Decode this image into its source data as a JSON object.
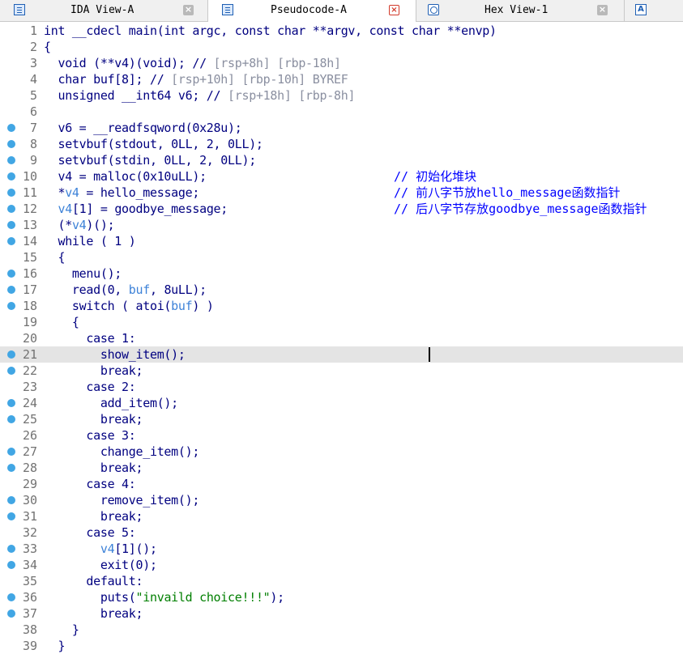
{
  "tabs": [
    {
      "label": "IDA View-A",
      "icon": "ida-view-icon",
      "active": false
    },
    {
      "label": "Pseudocode-A",
      "icon": "pseudocode-icon",
      "active": true
    },
    {
      "label": "Hex View-1",
      "icon": "hex-view-icon",
      "active": false
    },
    {
      "label": "",
      "icon": "structures-icon",
      "active": false
    }
  ],
  "close_glyph": "×",
  "struct_icon_glyph": "A",
  "code": {
    "highlighted_line": 21,
    "lines": [
      {
        "n": "1",
        "bp": false,
        "tokens": [
          [
            "int __cdecl main(int argc, const char **argv, const char **envp)",
            ""
          ]
        ]
      },
      {
        "n": "2",
        "bp": false,
        "tokens": [
          [
            "{",
            ""
          ]
        ]
      },
      {
        "n": "3",
        "bp": false,
        "tokens": [
          [
            "  void (**v4)(void); // ",
            ""
          ],
          [
            "[rsp+8h] [rbp-18h]",
            "gc"
          ]
        ]
      },
      {
        "n": "4",
        "bp": false,
        "tokens": [
          [
            "  char buf[8]; // ",
            ""
          ],
          [
            "[rsp+10h] [rbp-10h] BYREF",
            "gc"
          ]
        ]
      },
      {
        "n": "5",
        "bp": false,
        "tokens": [
          [
            "  unsigned __int64 v6; // ",
            ""
          ],
          [
            "[rsp+18h] [rbp-8h]",
            "gc"
          ]
        ]
      },
      {
        "n": "6",
        "bp": false,
        "tokens": []
      },
      {
        "n": "7",
        "bp": true,
        "tokens": [
          [
            "  v6 = __readfsqword(0x28u);",
            ""
          ]
        ]
      },
      {
        "n": "8",
        "bp": true,
        "tokens": [
          [
            "  setvbuf(stdout, 0LL, 2, 0LL);",
            ""
          ]
        ]
      },
      {
        "n": "9",
        "bp": true,
        "tokens": [
          [
            "  setvbuf(stdin, 0LL, 2, 0LL);",
            ""
          ]
        ]
      },
      {
        "n": "10",
        "bp": true,
        "tokens": [
          [
            "  v4 = malloc(0x10uLL);",
            ""
          ]
        ],
        "comment": "// 初始化堆块"
      },
      {
        "n": "11",
        "bp": true,
        "tokens": [
          [
            "  *",
            ""
          ],
          [
            "v4",
            "var"
          ],
          [
            " = hello_message;",
            ""
          ]
        ],
        "comment": "// 前八字节放hello_message函数指针"
      },
      {
        "n": "12",
        "bp": true,
        "tokens": [
          [
            "  ",
            ""
          ],
          [
            "v4",
            "var"
          ],
          [
            "[1] = goodbye_message;",
            ""
          ]
        ],
        "comment": "// 后八字节存放goodbye_message函数指针"
      },
      {
        "n": "13",
        "bp": true,
        "tokens": [
          [
            "  (*",
            ""
          ],
          [
            "v4",
            "var"
          ],
          [
            ")();",
            ""
          ]
        ]
      },
      {
        "n": "14",
        "bp": true,
        "tokens": [
          [
            "  while ( 1 )",
            ""
          ]
        ]
      },
      {
        "n": "15",
        "bp": false,
        "tokens": [
          [
            "  {",
            ""
          ]
        ]
      },
      {
        "n": "16",
        "bp": true,
        "tokens": [
          [
            "    menu();",
            ""
          ]
        ]
      },
      {
        "n": "17",
        "bp": true,
        "tokens": [
          [
            "    read(0, ",
            ""
          ],
          [
            "buf",
            "var"
          ],
          [
            ", 8uLL);",
            ""
          ]
        ]
      },
      {
        "n": "18",
        "bp": true,
        "tokens": [
          [
            "    switch ( atoi(",
            ""
          ],
          [
            "buf",
            "var"
          ],
          [
            ") )",
            ""
          ]
        ]
      },
      {
        "n": "19",
        "bp": false,
        "tokens": [
          [
            "    {",
            ""
          ]
        ]
      },
      {
        "n": "20",
        "bp": false,
        "tokens": [
          [
            "      case 1:",
            ""
          ]
        ]
      },
      {
        "n": "21",
        "bp": true,
        "tokens": [
          [
            "        show_item();",
            ""
          ]
        ]
      },
      {
        "n": "22",
        "bp": true,
        "tokens": [
          [
            "        break;",
            ""
          ]
        ]
      },
      {
        "n": "23",
        "bp": false,
        "tokens": [
          [
            "      case 2:",
            ""
          ]
        ]
      },
      {
        "n": "24",
        "bp": true,
        "tokens": [
          [
            "        add_item();",
            ""
          ]
        ]
      },
      {
        "n": "25",
        "bp": true,
        "tokens": [
          [
            "        break;",
            ""
          ]
        ]
      },
      {
        "n": "26",
        "bp": false,
        "tokens": [
          [
            "      case 3:",
            ""
          ]
        ]
      },
      {
        "n": "27",
        "bp": true,
        "tokens": [
          [
            "        change_item();",
            ""
          ]
        ]
      },
      {
        "n": "28",
        "bp": true,
        "tokens": [
          [
            "        break;",
            ""
          ]
        ]
      },
      {
        "n": "29",
        "bp": false,
        "tokens": [
          [
            "      case 4:",
            ""
          ]
        ]
      },
      {
        "n": "30",
        "bp": true,
        "tokens": [
          [
            "        remove_item();",
            ""
          ]
        ]
      },
      {
        "n": "31",
        "bp": true,
        "tokens": [
          [
            "        break;",
            ""
          ]
        ]
      },
      {
        "n": "32",
        "bp": false,
        "tokens": [
          [
            "      case 5:",
            ""
          ]
        ]
      },
      {
        "n": "33",
        "bp": true,
        "tokens": [
          [
            "        ",
            ""
          ],
          [
            "v4",
            "var"
          ],
          [
            "[1]();",
            ""
          ]
        ]
      },
      {
        "n": "34",
        "bp": true,
        "tokens": [
          [
            "        exit(0);",
            ""
          ]
        ]
      },
      {
        "n": "35",
        "bp": false,
        "tokens": [
          [
            "      default:",
            ""
          ]
        ]
      },
      {
        "n": "36",
        "bp": true,
        "tokens": [
          [
            "        puts(",
            ""
          ],
          [
            "\"invaild choice!!!\"",
            "str"
          ],
          [
            ");",
            ""
          ]
        ]
      },
      {
        "n": "37",
        "bp": true,
        "tokens": [
          [
            "        break;",
            ""
          ]
        ]
      },
      {
        "n": "38",
        "bp": false,
        "tokens": [
          [
            "    }",
            ""
          ]
        ]
      },
      {
        "n": "39",
        "bp": false,
        "tokens": [
          [
            "  }",
            ""
          ]
        ]
      }
    ]
  }
}
